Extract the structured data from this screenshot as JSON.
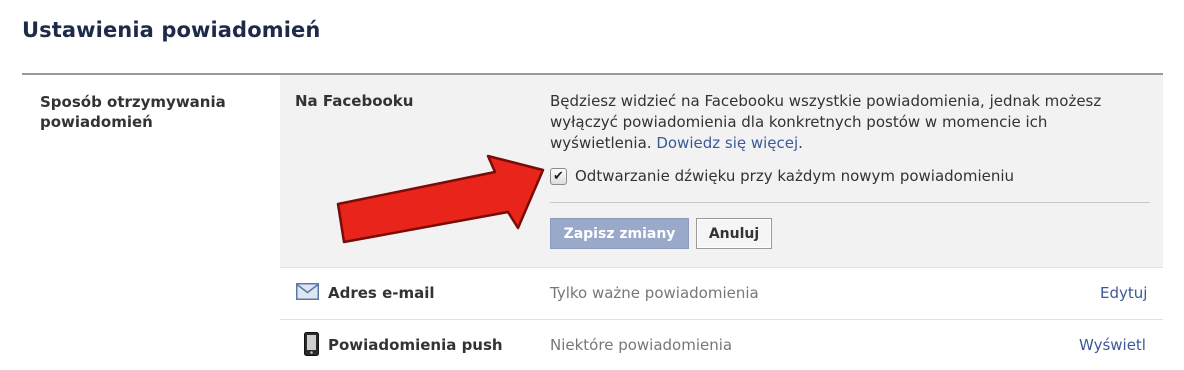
{
  "page": {
    "title": "Ustawienia powiadomień"
  },
  "section": {
    "label": "Sposób otrzymywania powiadomień"
  },
  "facebook": {
    "title": "Na Facebooku",
    "description": "Będziesz widzieć na Facebooku wszystkie powiadomienia, jednak możesz wyłączyć powiadomienia dla konkretnych postów w momencie ich wyświetlenia.",
    "learn_more": "Dowiedz się więcej",
    "period": ".",
    "checkbox_label": "Odtwarzanie dźwięku przy każdym nowym powiadomieniu",
    "checkbox_checked": true,
    "save_label": "Zapisz zmiany",
    "cancel_label": "Anuluj"
  },
  "rows": [
    {
      "icon": "envelope-icon",
      "label": "Adres e-mail",
      "value": "Tylko ważne powiadomienia",
      "action": "Edytuj"
    },
    {
      "icon": "mobile-phone-icon",
      "label": "Powiadomienia push",
      "value": "Niektóre powiadomienia",
      "action": "Wyświetl"
    }
  ],
  "colors": {
    "title": "#1d2a48",
    "link": "#3b5998",
    "save_button": "#9aa9c9",
    "expanded_bg": "#f2f2f2",
    "arrow": "#e8241b"
  }
}
